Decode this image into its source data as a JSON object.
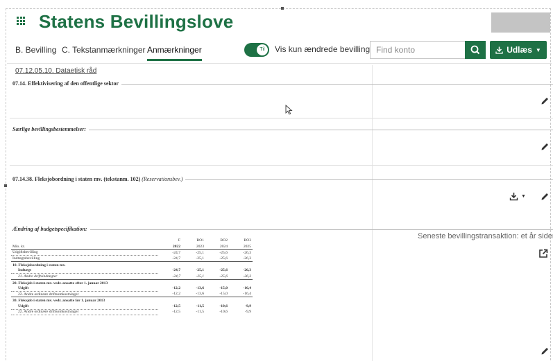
{
  "header": {
    "app_title": "Statens Bevillingslove",
    "menu_icon": "grid-icon"
  },
  "tabs": [
    {
      "label": "B. Bevilling",
      "active": false
    },
    {
      "label": "C. Tekstanmærkninger",
      "active": false
    },
    {
      "label": "Anmærkninger",
      "active": true
    }
  ],
  "filter": {
    "toggle_text": "Til",
    "toggle_label": "Vis kun ændrede bevillinger",
    "toggle_on": true
  },
  "search": {
    "placeholder": "Find konto",
    "icon": "search-icon"
  },
  "export": {
    "label": "Udlæs",
    "icon": "download-icon"
  },
  "breadcrumb": "07.12.05.10. Dataetisk råd",
  "sections": {
    "s1_title": "07.14. Effektivisering af den offentlige sektor",
    "s2_title": "Særlige bevillingsbestemmelser:",
    "s3_title": "07.14.38. Fleksjobordning i staten mv. (tekstanm. 102)",
    "s3_note": "(Reservationsbev.)",
    "s4_title": "Ændring af budgetspecifikation:"
  },
  "budget_table": {
    "unit_label": "Mio. kr.",
    "columns_top": [
      "F",
      "BO1",
      "BO2",
      "BO3"
    ],
    "columns_bottom": [
      "2022",
      "2023",
      "2024",
      "2025"
    ],
    "rows": [
      {
        "label": "Udgiftsbevilling",
        "values": [
          "-24,7",
          "-25,1",
          "-25,6",
          "-26,3"
        ],
        "style": "plain"
      },
      {
        "label": "Indtægtsbevilling",
        "values": [
          "-24,7",
          "-25,1",
          "-25,6",
          "-26,3"
        ],
        "style": "plain"
      },
      {
        "label": "10. Fleksjobordning i staten mv.",
        "values": [
          "",
          "",
          "",
          ""
        ],
        "style": "group"
      },
      {
        "label": "Indtægt",
        "values": [
          "-24,7",
          "-25,1",
          "-25,6",
          "-26,3"
        ],
        "style": "bold"
      },
      {
        "label": "21. Andre driftsindtægter",
        "values": [
          "-24,7",
          "-25,1",
          "-25,6",
          "-26,3"
        ],
        "style": "ital"
      },
      {
        "label": "20. Fleksjob i staten mv. vedr. ansatte efter 1. januar 2013",
        "values": [
          "",
          "",
          "",
          ""
        ],
        "style": "group"
      },
      {
        "label": "Udgift",
        "values": [
          "-12,2",
          "-13,6",
          "-15,0",
          "-16,4"
        ],
        "style": "bold"
      },
      {
        "label": "22. Andre ordinære driftsomkostninger",
        "values": [
          "-12,2",
          "-13,6",
          "-15,0",
          "-16,4"
        ],
        "style": "plain"
      },
      {
        "label": "30. Fleksjob i staten mv. vedr. ansatte før 1. januar 2013",
        "values": [
          "",
          "",
          "",
          ""
        ],
        "style": "group"
      },
      {
        "label": "Udgift",
        "values": [
          "-12,5",
          "-11,5",
          "-10,6",
          "-9,9"
        ],
        "style": "bold"
      },
      {
        "label": "22. Andre ordinære driftsomkostninger",
        "values": [
          "-12,5",
          "-11,5",
          "-10,6",
          "-9,9"
        ],
        "style": "plain"
      }
    ]
  },
  "right_panel": {
    "recent_transaction": "Seneste bevillingstransaktion: et år siden"
  },
  "icons": {
    "edit": "pencil-icon",
    "download": "download-icon",
    "external": "external-link-icon"
  },
  "colors": {
    "brand": "#1e7145",
    "placeholder_box": "#c4c4c4"
  }
}
